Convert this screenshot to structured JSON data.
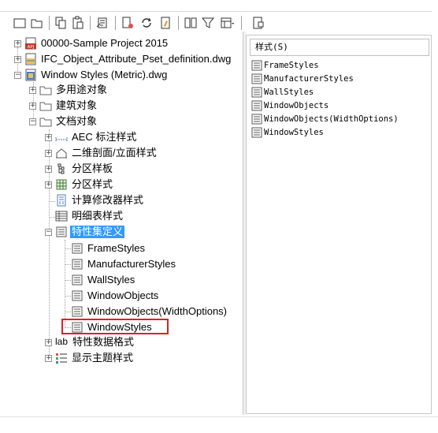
{
  "toolbar": {
    "buttons": [
      {
        "name": "new-icon"
      },
      {
        "name": "open-icon"
      },
      {
        "name": "copy-icon"
      },
      {
        "name": "paste-icon"
      },
      {
        "name": "purge-icon"
      },
      {
        "name": "edit-style-icon"
      },
      {
        "name": "synchronize-icon"
      },
      {
        "name": "properties-icon"
      },
      {
        "name": "inventory-icon"
      },
      {
        "name": "filter-icon"
      },
      {
        "name": "view-icon"
      },
      {
        "name": "toggle-view-icon"
      }
    ]
  },
  "tree": {
    "items": [
      {
        "label": "00000-Sample Project 2015"
      },
      {
        "label": "IFC_Object_Attribute_Pset_definition.dwg"
      },
      {
        "label": "Window Styles (Metric).dwg"
      },
      {
        "label": "多用途对象"
      },
      {
        "label": "建筑对象"
      },
      {
        "label": "文档对象"
      },
      {
        "label": "AEC 标注样式"
      },
      {
        "label": "二维剖面/立面样式"
      },
      {
        "label": "分区样板"
      },
      {
        "label": "分区样式"
      },
      {
        "label": "计算修改器样式"
      },
      {
        "label": "明细表样式"
      },
      {
        "label": "特性集定义"
      },
      {
        "label": "FrameStyles"
      },
      {
        "label": "ManufacturerStyles"
      },
      {
        "label": "WallStyles"
      },
      {
        "label": "WindowObjects"
      },
      {
        "label": "WindowObjects(WidthOptions)"
      },
      {
        "label": "WindowStyles"
      },
      {
        "label": "特性数据格式"
      },
      {
        "label": "显示主题样式"
      }
    ],
    "project_badge": "APJ",
    "lab_prefix": "lab"
  },
  "list": {
    "header": "样式(S)",
    "items": [
      {
        "label": "FrameStyles"
      },
      {
        "label": "ManufacturerStyles"
      },
      {
        "label": "WallStyles"
      },
      {
        "label": "WindowObjects"
      },
      {
        "label": "WindowObjects(WidthOptions)"
      },
      {
        "label": "WindowStyles"
      }
    ]
  },
  "colors": {
    "selection": "#3399ff",
    "highlight_box": "#e02020",
    "project_icon": "#c0392b",
    "drawing_icon": "#4a7ebb"
  }
}
